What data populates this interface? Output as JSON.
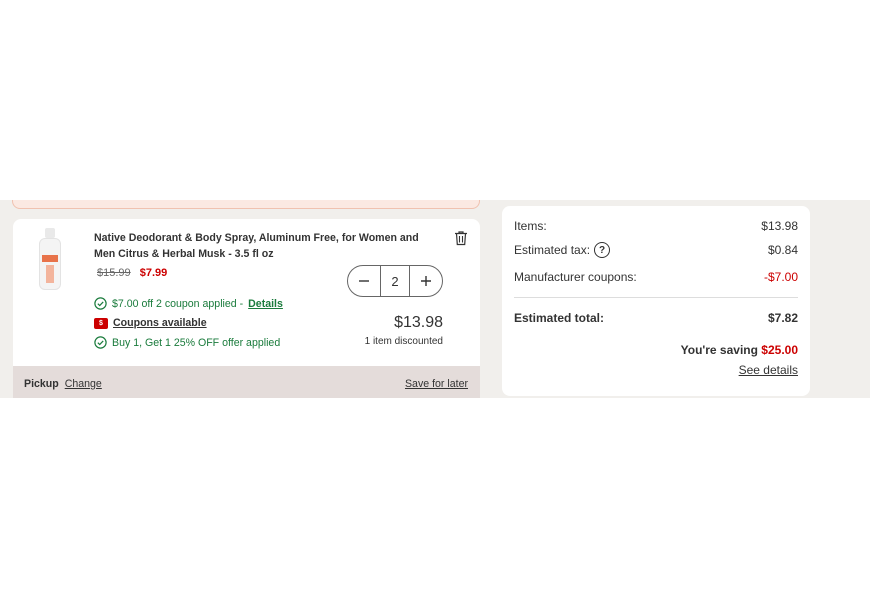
{
  "cart": {
    "product_title": "Native Deodorant & Body Spray, Aluminum Free, for Women and Men Citrus & Herbal Musk - 3.5 fl oz",
    "original_price": "$15.99",
    "sale_price": "$7.99",
    "quantity": "2",
    "coupon_applied_text": "$7.00 off 2 coupon applied -",
    "details_label": "Details",
    "coupons_available_label": "Coupons available",
    "offer_applied_text": "Buy 1, Get 1 25% OFF offer applied",
    "line_total": "$13.98",
    "discount_note": "1 item discounted",
    "pickup_label": "Pickup",
    "change_label": "Change",
    "save_for_later_label": "Save for later",
    "tag_text": "$",
    "icons": [
      "trash-icon",
      "minus-icon",
      "plus-icon",
      "check-circle-icon",
      "coupon-tag-icon"
    ]
  },
  "summary": {
    "items_label": "Items:",
    "items_value": "$13.98",
    "tax_label": "Estimated tax:",
    "tax_help": "?",
    "tax_value": "$0.84",
    "coupons_label": "Manufacturer coupons:",
    "coupons_value": "-$7.00",
    "total_label": "Estimated total:",
    "total_value": "$7.82",
    "saving_label": "You're saving",
    "saving_value": "$25.00",
    "see_details_label": "See details"
  },
  "colors": {
    "sale_red": "#cc0000",
    "success_green": "#1a7b3c",
    "page_band": "#f1efec",
    "footer_bar": "#e4dcda"
  }
}
